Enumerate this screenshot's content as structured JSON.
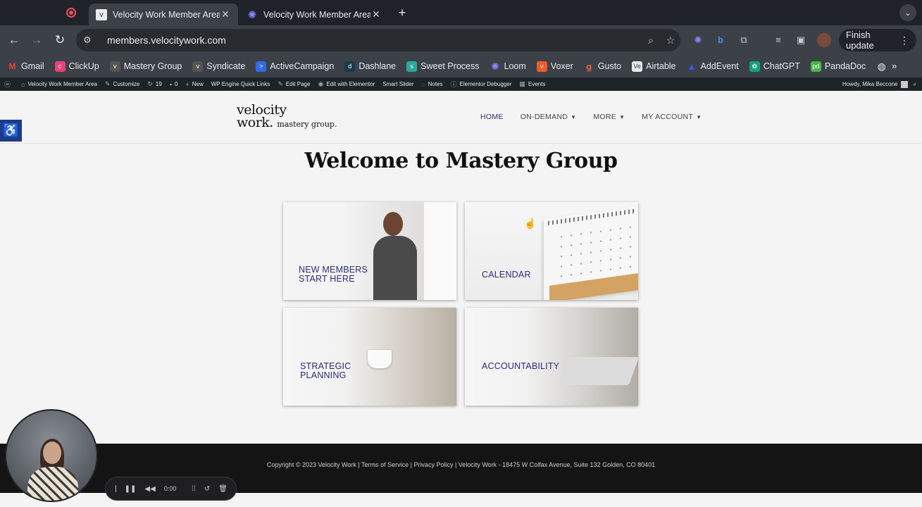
{
  "browser": {
    "tabs": [
      {
        "title": "Velocity Work Member Area –",
        "active": true
      },
      {
        "title": "Velocity Work Member Area –",
        "active": false
      }
    ],
    "url": "members.velocitywork.com",
    "finish_update_label": "Finish update",
    "bookmarks": [
      {
        "label": "Gmail",
        "icon": "gmail-icon",
        "color": "#ea4335"
      },
      {
        "label": "ClickUp",
        "icon": "clickup-icon",
        "color": "#e8417a"
      },
      {
        "label": "Mastery Group",
        "icon": "velocity-icon",
        "color": "#555555"
      },
      {
        "label": "Syndicate",
        "icon": "velocity-icon",
        "color": "#555555"
      },
      {
        "label": "ActiveCampaign",
        "icon": "activecampaign-icon",
        "color": "#356ae6"
      },
      {
        "label": "Dashlane",
        "icon": "dashlane-icon",
        "color": "#1a3a4a"
      },
      {
        "label": "Sweet Process",
        "icon": "sweetprocess-icon",
        "color": "#2aa8a0"
      },
      {
        "label": "Loom",
        "icon": "loom-icon",
        "color": "#625df5"
      },
      {
        "label": "Voxer",
        "icon": "voxer-icon",
        "color": "#f05a28"
      },
      {
        "label": "Gusto",
        "icon": "gusto-icon",
        "color": "#f45d48"
      },
      {
        "label": "Airtable",
        "icon": "airtable-icon",
        "color": "#e8eaed"
      },
      {
        "label": "AddEvent",
        "icon": "addevent-icon",
        "color": "#2e5bff"
      },
      {
        "label": "ChatGPT",
        "icon": "chatgpt-icon",
        "color": "#10a37f"
      },
      {
        "label": "PandaDoc",
        "icon": "pandadoc-icon",
        "color": "#4bb543"
      }
    ]
  },
  "adminbar": {
    "items": [
      {
        "label": "Velocity Work Member Area",
        "icon": "home-icon"
      },
      {
        "label": "Customize",
        "icon": "brush-icon"
      },
      {
        "label": "19",
        "icon": "updates-icon"
      },
      {
        "label": "0",
        "icon": "comments-icon"
      },
      {
        "label": "New",
        "icon": "plus-icon"
      },
      {
        "label": "WP Engine Quick Links",
        "icon": ""
      },
      {
        "label": "Edit Page",
        "icon": "pencil-icon"
      },
      {
        "label": "Edit with Elementor",
        "icon": "elementor-icon"
      },
      {
        "label": "Smart Slider",
        "icon": ""
      },
      {
        "label": "Notes",
        "icon": "speech-icon"
      },
      {
        "label": "Elementor Debugger",
        "icon": "info-icon"
      },
      {
        "label": "Events",
        "icon": "calendar-icon"
      }
    ],
    "greeting": "Howdy, Mika Beccone"
  },
  "site": {
    "logo_line1": "velocity",
    "logo_line2": "work.",
    "logo_suffix": "mastery group.",
    "nav": [
      {
        "label": "HOME",
        "active": true,
        "dropdown": false
      },
      {
        "label": "ON-DEMAND",
        "active": false,
        "dropdown": true
      },
      {
        "label": "MORE",
        "active": false,
        "dropdown": true
      },
      {
        "label": "MY ACCOUNT",
        "active": false,
        "dropdown": true
      }
    ],
    "heading": "Welcome to Mastery Group",
    "cards": {
      "new_members": {
        "line1": "NEW MEMBERS",
        "line2": "START HERE"
      },
      "calendar": {
        "line1": "CALENDAR"
      },
      "strategic": {
        "line1": "STRATEGIC",
        "line2": "PLANNING"
      },
      "accountability": {
        "line1": "ACCOUNTABILITY"
      }
    },
    "footer": {
      "copyright": "Copyright © 2023 Velocity Work",
      "terms": "Terms of Service",
      "privacy": "Privacy Policy",
      "address": "Velocity Work - 18475 W Colfax Avenue, Suite 132 Golden, CO 80401"
    }
  },
  "loom": {
    "time": "0:00"
  },
  "colors": {
    "brand_navy": "#2d2a7a",
    "a11y_blue": "#1d3a8a",
    "footer_bg": "#141414"
  }
}
